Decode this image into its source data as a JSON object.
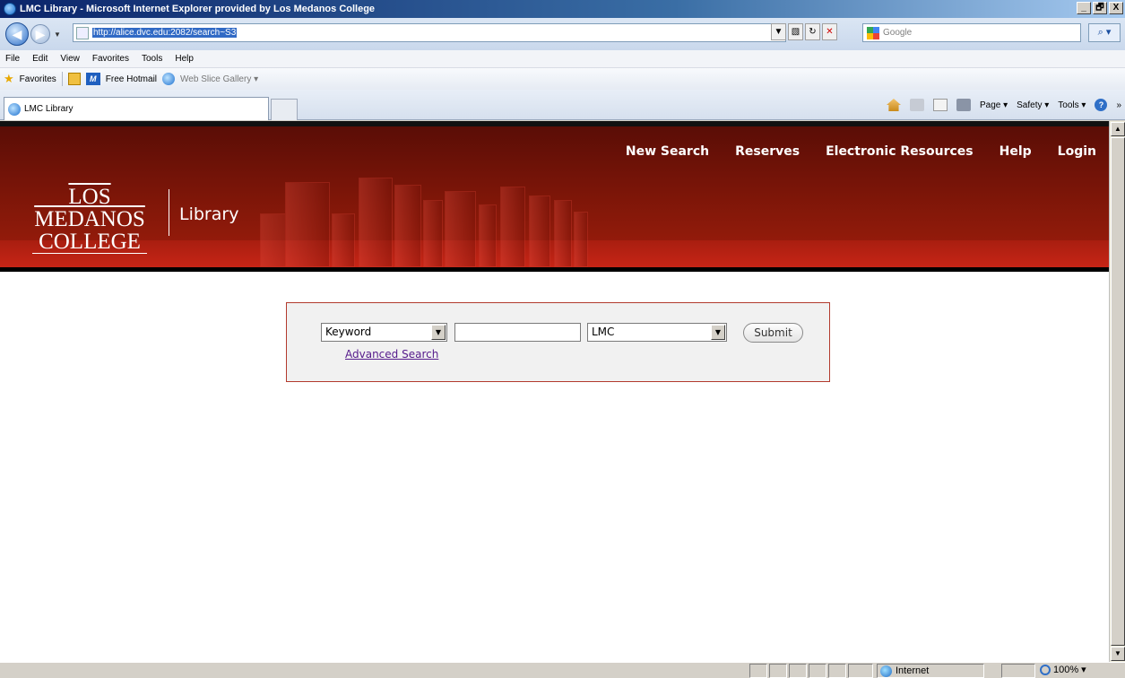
{
  "window": {
    "title": "LMC Library - Microsoft Internet Explorer provided by Los Medanos College",
    "controls": [
      "_",
      "🗗",
      "X"
    ]
  },
  "address": {
    "url": "http://alice.dvc.edu:2082/search~S3",
    "search_placeholder": "Google"
  },
  "menu": [
    "File",
    "Edit",
    "View",
    "Favorites",
    "Tools",
    "Help"
  ],
  "favorites_bar": {
    "favorites_label": "Favorites",
    "items": [
      "Free Hotmail",
      "Web Slice Gallery ▾"
    ]
  },
  "tab": {
    "label": "LMC Library"
  },
  "command_bar": {
    "page_label": "Page ▾",
    "safety_label": "Safety ▾",
    "tools_label": "Tools ▾",
    "more": "»"
  },
  "site": {
    "logo_line1": "LOS MEDANOS",
    "logo_line2": "COLLEGE",
    "logo_library": "Library",
    "nav": [
      "New Search",
      "Reserves",
      "Electronic Resources",
      "Help",
      "Login"
    ]
  },
  "search": {
    "type_value": "Keyword",
    "query_value": "",
    "location_value": "LMC",
    "submit_label": "Submit",
    "advanced_link": "Advanced Search"
  },
  "status": {
    "zone": "Internet",
    "zoom": "100%"
  },
  "colors": {
    "header_red": "#7a1508",
    "search_border": "#b23a2d",
    "link_visited": "#551a8b"
  }
}
